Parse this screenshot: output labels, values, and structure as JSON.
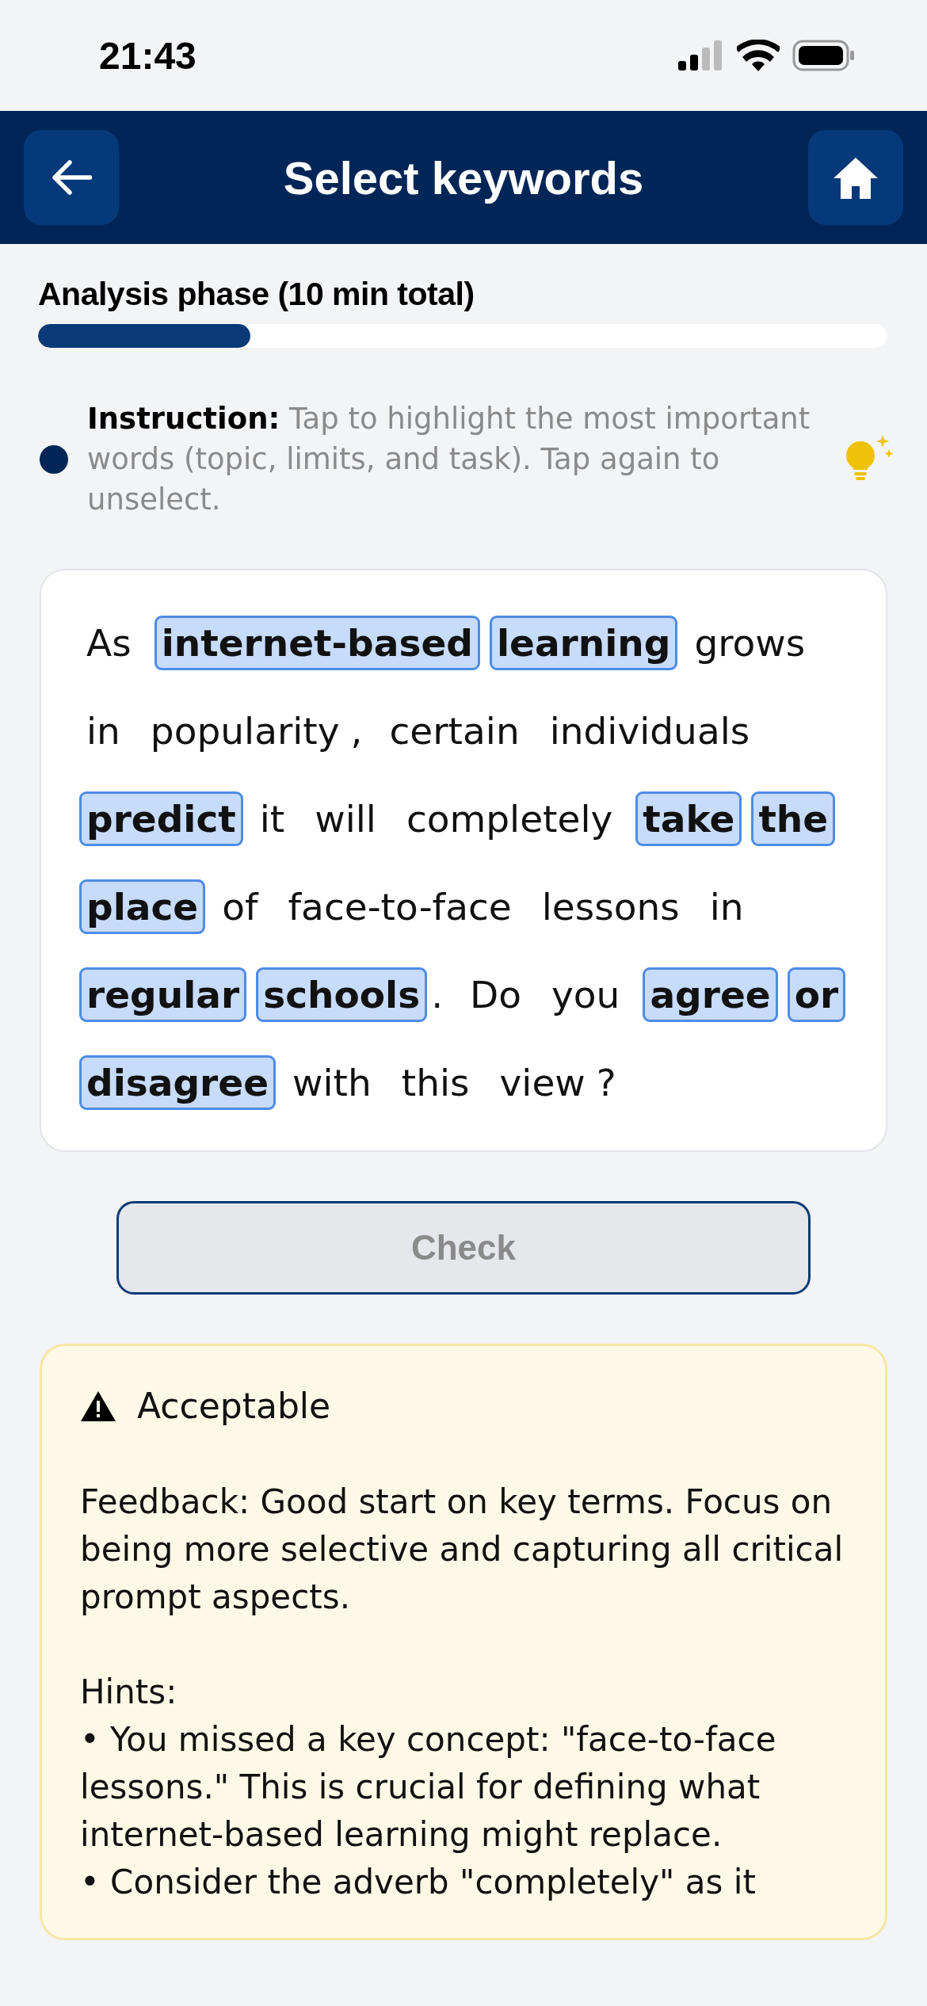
{
  "status_bar": {
    "time": "21:43"
  },
  "header": {
    "title": "Select keywords"
  },
  "progress": {
    "label": "Analysis phase (10 min total)",
    "level": 0.25
  },
  "instruction": {
    "text": "**Instruction:** Tap to highlight the most important words (topic, limits, and task). Tap again to unselect."
  },
  "passage": {
    "lines": [
      [
        {
          "kind": "word",
          "text": "As",
          "selected": false
        },
        {
          "kind": "word",
          "text": "internet-based",
          "selected": true
        },
        {
          "kind": "word",
          "text": "learning",
          "selected": true
        },
        {
          "kind": "word",
          "text": "grows",
          "selected": false
        }
      ],
      [
        {
          "kind": "word",
          "text": "in",
          "selected": false
        },
        {
          "kind": "word",
          "text": "popularity",
          "selected": false
        },
        {
          "kind": "punct",
          "text": ","
        },
        {
          "kind": "word",
          "text": "certain",
          "selected": false
        },
        {
          "kind": "word",
          "text": "individuals",
          "selected": false
        }
      ],
      [
        {
          "kind": "word",
          "text": "predict",
          "selected": true
        },
        {
          "kind": "word",
          "text": "it",
          "selected": false
        },
        {
          "kind": "word",
          "text": "will",
          "selected": false
        },
        {
          "kind": "word",
          "text": "completely",
          "selected": false
        },
        {
          "kind": "word",
          "text": "take",
          "selected": true
        },
        {
          "kind": "word",
          "text": "the",
          "selected": true
        }
      ],
      [
        {
          "kind": "word",
          "text": "place",
          "selected": true
        },
        {
          "kind": "word",
          "text": "of",
          "selected": false
        },
        {
          "kind": "word",
          "text": "face-to-face",
          "selected": false
        },
        {
          "kind": "word",
          "text": "lessons",
          "selected": false
        },
        {
          "kind": "word",
          "text": "in",
          "selected": false
        }
      ],
      [
        {
          "kind": "word",
          "text": "regular",
          "selected": true
        },
        {
          "kind": "word",
          "text": "schools",
          "selected": true
        },
        {
          "kind": "punct",
          "text": "."
        },
        {
          "kind": "word",
          "text": "Do",
          "selected": false
        },
        {
          "kind": "word",
          "text": "you",
          "selected": false
        },
        {
          "kind": "word",
          "text": "agree",
          "selected": true
        },
        {
          "kind": "word",
          "text": "or",
          "selected": true
        }
      ],
      [
        {
          "kind": "word",
          "text": "disagree",
          "selected": true
        },
        {
          "kind": "word",
          "text": "with",
          "selected": false
        },
        {
          "kind": "word",
          "text": "this",
          "selected": false
        },
        {
          "kind": "word",
          "text": "view",
          "selected": false
        },
        {
          "kind": "punct",
          "text": "?"
        }
      ]
    ]
  },
  "check_button": {
    "label": "Check",
    "disabled": true
  },
  "feedback": {
    "rating": "Acceptable",
    "text": "Feedback: Good start on key terms. Focus on being more selective and capturing all critical prompt aspects.",
    "hints_label": "Hints:",
    "hints": [
      "• You missed a key concept: \"face-to-face lessons.\" This is crucial for defining what internet-based learning might replace.",
      "• Consider the adverb \"completely\" as it"
    ]
  }
}
